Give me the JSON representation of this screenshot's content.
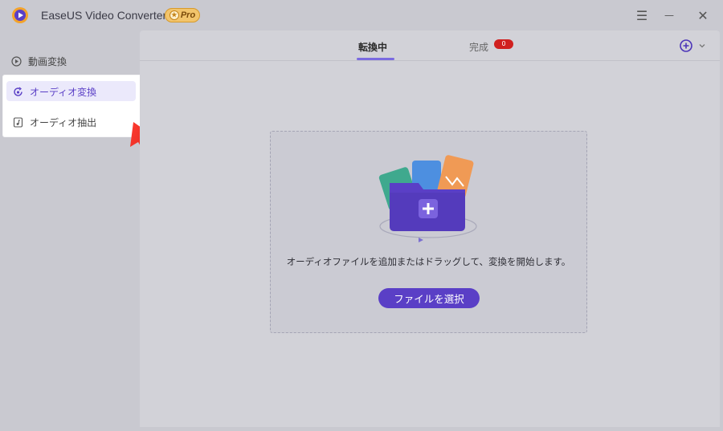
{
  "app": {
    "title": "EaseUS Video Converter",
    "badge": "Pro"
  },
  "window_controls": {
    "menu": "☰",
    "minimize": "—",
    "close": "✕"
  },
  "sidebar": {
    "items": [
      {
        "label": "動画変換",
        "icon": "video-convert-icon",
        "active": false
      },
      {
        "label": "オーディオ変換",
        "icon": "audio-convert-icon",
        "active": true
      },
      {
        "label": "オーディオ抽出",
        "icon": "audio-extract-icon",
        "active": false
      }
    ]
  },
  "tabs": {
    "converting": "転換中",
    "done": "完成",
    "done_count": "0"
  },
  "dropzone": {
    "hint": "オーディオファイルを追加またはドラッグして、変換を開始します。",
    "select_button": "ファイルを選択"
  },
  "colors": {
    "accent": "#5a3fc6",
    "active_bg": "#ebe9fb",
    "active_text": "#5a3fc6",
    "badge_red": "#d0201f",
    "annotation_arrow": "#e8231f"
  }
}
